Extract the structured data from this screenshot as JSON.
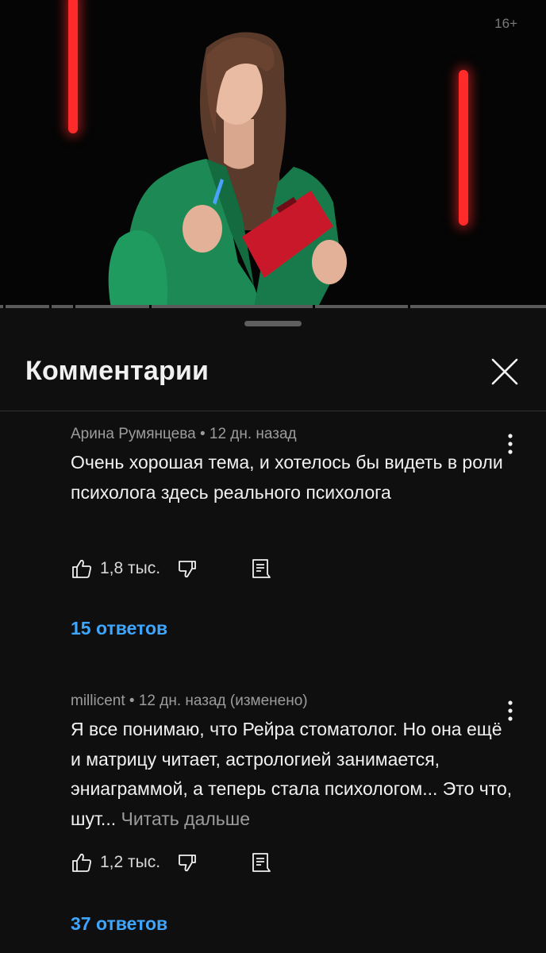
{
  "video": {
    "age_rating": "16+",
    "progress_fraction": 0.0
  },
  "sheet": {
    "title": "Комментарии",
    "close_icon": "close-icon"
  },
  "comments": [
    {
      "author": "Арина Румянцева",
      "time": "12 дн. назад",
      "meta": "Арина Румянцева • 12 дн. назад",
      "text": "Очень хорошая тема, и хотелось бы видеть в роли психолога здесь реального психолога",
      "likes": "1,8 тыс.",
      "replies": "15 ответов"
    },
    {
      "author": "millicent",
      "time": "12 дн. назад (изменено)",
      "meta": "millicent • 12 дн. назад (изменено)",
      "text": "Я все понимаю, что Рейра стоматолог.  Но она ещё и матрицу читает, астрологией занимается, эниаграммой, а теперь стала психологом... Это что, шут... ",
      "read_more": "Читать дальше",
      "likes": "1,2 тыс.",
      "replies": "37 ответов"
    }
  ],
  "colors": {
    "background": "#0f0f0f",
    "link": "#3ea6ff",
    "neon": "#ff2a2a"
  }
}
